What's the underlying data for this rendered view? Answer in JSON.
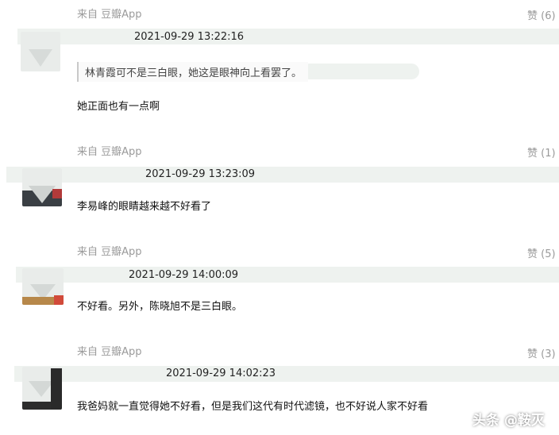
{
  "comments": [
    {
      "source": "来自 豆瓣App",
      "likes": "赞 (6)",
      "timestamp": "2021-09-29 13:22:16",
      "quote": "林青霞可不是三白眼，她这是眼神向上看罢了。",
      "text": "她正面也有一点啊"
    },
    {
      "source": "来自 豆瓣App",
      "likes": "赞 (1)",
      "timestamp": "2021-09-29 13:23:09",
      "text": "李易峰的眼睛越来越不好看了"
    },
    {
      "source": "来自 豆瓣App",
      "likes": "赞 (5)",
      "timestamp": "2021-09-29 14:00:09",
      "text": "不好看。另外，陈晓旭不是三白眼。"
    },
    {
      "source": "来自 豆瓣App",
      "likes": "赞 (3)",
      "timestamp": "2021-09-29 14:02:23",
      "text": "我爸妈就一直觉得她不好看，但是我们这代有时代滤镜，也不好说人家不好看"
    }
  ],
  "watermark": "头条 @鞍灭"
}
